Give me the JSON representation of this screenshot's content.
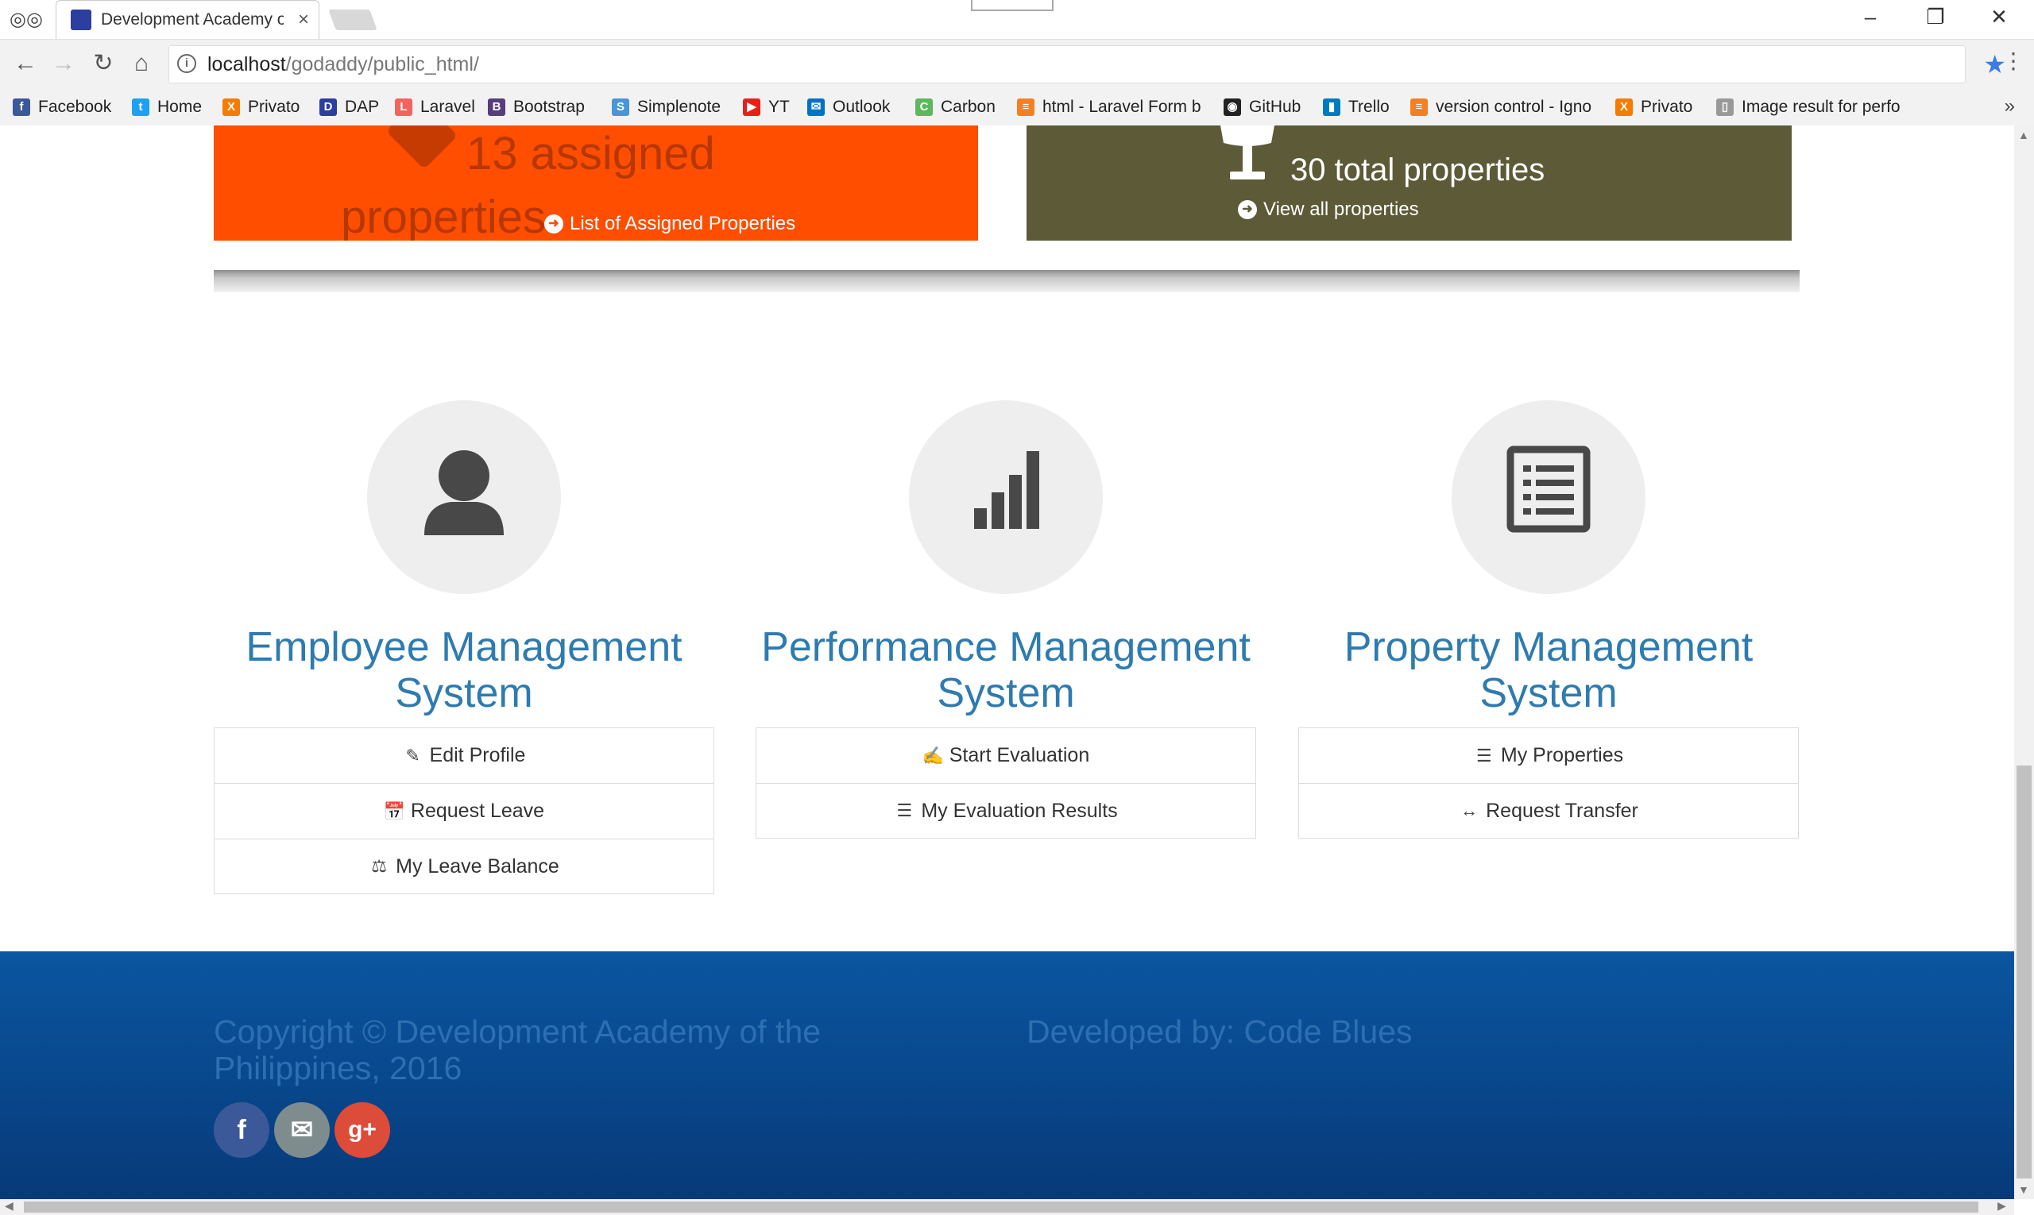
{
  "browser": {
    "tab_title": "Development Academy o",
    "url_host": "localhost",
    "url_path": "/godaddy/public_html/",
    "bookmarks": [
      {
        "label": "Facebook",
        "color": "#3b5998",
        "glyph": "f"
      },
      {
        "label": "Home",
        "color": "#1da1f2",
        "glyph": "t"
      },
      {
        "label": "Privato",
        "color": "#f57c00",
        "glyph": "X"
      },
      {
        "label": "DAP",
        "color": "#2c3e9e",
        "glyph": "D"
      },
      {
        "label": "Laravel",
        "color": "#f4645f",
        "glyph": "L"
      },
      {
        "label": "Bootstrap",
        "color": "#563d7c",
        "glyph": "B"
      },
      {
        "label": "Simplenote",
        "color": "#4895d9",
        "glyph": "S"
      },
      {
        "label": "YT",
        "color": "#e62117",
        "glyph": "▶"
      },
      {
        "label": "Outlook",
        "color": "#0072c6",
        "glyph": "✉"
      },
      {
        "label": "Carbon",
        "color": "#5cb85c",
        "glyph": "C"
      },
      {
        "label": "html - Laravel Form b",
        "color": "#f48024",
        "glyph": "≡"
      },
      {
        "label": "GitHub",
        "color": "#222222",
        "glyph": "◉"
      },
      {
        "label": "Trello",
        "color": "#0079bf",
        "glyph": "▮"
      },
      {
        "label": "version control - Igno",
        "color": "#f48024",
        "glyph": "≡"
      },
      {
        "label": "Privato",
        "color": "#f57c00",
        "glyph": "X"
      },
      {
        "label": "Image result for perfo",
        "color": "#999999",
        "glyph": "▯"
      }
    ],
    "more": "»"
  },
  "panels": {
    "orange": {
      "line1": "13 assigned",
      "line2": "properties",
      "link": "List of Assigned Properties",
      "color": "#ff4e00"
    },
    "olive": {
      "text": "30 total properties",
      "link": "View all properties",
      "color": "#5c5a37"
    }
  },
  "systems": [
    {
      "title": "Employee Management System",
      "icon": "user-icon",
      "items": [
        {
          "label": "Edit Profile",
          "icon": "pencil-icon"
        },
        {
          "label": "Request Leave",
          "icon": "calendar-plus-icon"
        },
        {
          "label": "My Leave Balance",
          "icon": "scale-icon"
        }
      ]
    },
    {
      "title": "Performance Management System",
      "icon": "signal-bars-icon",
      "items": [
        {
          "label": "Start Evaluation",
          "icon": "edit-square-icon"
        },
        {
          "label": "My Evaluation Results",
          "icon": "list-card-icon"
        }
      ]
    },
    {
      "title": "Property Management System",
      "icon": "list-document-icon",
      "items": [
        {
          "label": "My Properties",
          "icon": "list-card-icon"
        },
        {
          "label": "Request Transfer",
          "icon": "double-arrow-icon"
        }
      ]
    }
  ],
  "footer": {
    "copyright": "Copyright © Development Academy of the Philippines, 2016",
    "developed_by": "Developed by: Code Blues",
    "social": [
      {
        "name": "facebook",
        "glyph": "f",
        "color": "#3b5998"
      },
      {
        "name": "email",
        "glyph": "✉",
        "color": "#7f8c8d"
      },
      {
        "name": "google-plus",
        "glyph": "g+",
        "color": "#dd4b39"
      }
    ]
  }
}
